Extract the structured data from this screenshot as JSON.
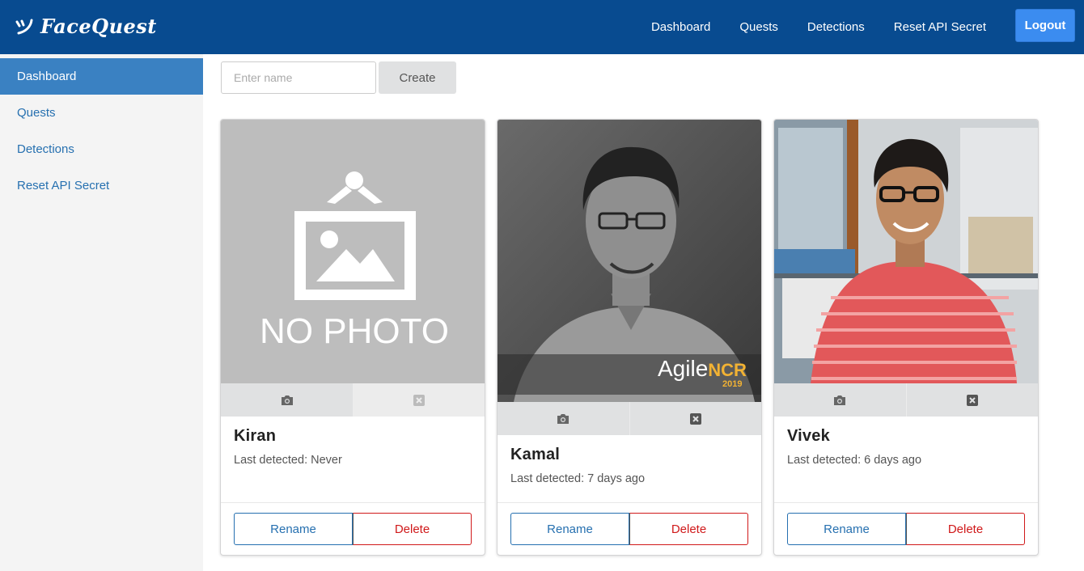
{
  "brand": {
    "name": "FaceQuest",
    "icon": "facequest-logo-icon"
  },
  "topnav": {
    "items": [
      {
        "label": "Dashboard"
      },
      {
        "label": "Quests"
      },
      {
        "label": "Detections"
      },
      {
        "label": "Reset API Secret"
      }
    ],
    "logout_label": "Logout"
  },
  "sidebar": {
    "items": [
      {
        "label": "Dashboard",
        "active": true
      },
      {
        "label": "Quests",
        "active": false
      },
      {
        "label": "Detections",
        "active": false
      },
      {
        "label": "Reset API Secret",
        "active": false
      }
    ]
  },
  "create_form": {
    "placeholder": "Enter name",
    "value": "",
    "button_label": "Create"
  },
  "cards": [
    {
      "name": "Kiran",
      "last_detected": "Last detected: Never",
      "photo": "no-photo-placeholder",
      "photo_text": "NO PHOTO",
      "rename_label": "Rename",
      "delete_label": "Delete"
    },
    {
      "name": "Kamal",
      "last_detected": "Last detected: 7 days ago",
      "photo": "grayscale-portrait",
      "photo_text": "AgileNCR 2019",
      "rename_label": "Rename",
      "delete_label": "Delete"
    },
    {
      "name": "Vivek",
      "last_detected": "Last detected: 6 days ago",
      "photo": "color-portrait",
      "rename_label": "Rename",
      "delete_label": "Delete"
    }
  ],
  "icons": {
    "camera": "camera-icon",
    "remove": "remove-photo-icon"
  },
  "colors": {
    "header": "#084b90",
    "logout": "#3b8cf0",
    "sidebar_active": "#3a81c2",
    "link": "#2670b0",
    "danger": "#d0191a"
  }
}
